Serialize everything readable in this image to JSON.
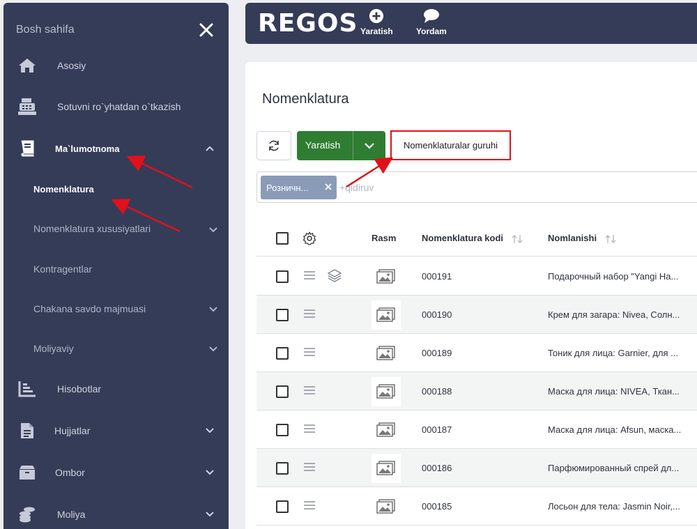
{
  "sidebar": {
    "header": "Bosh sahifa",
    "items": [
      {
        "label": "Asosiy",
        "icon": "home-icon"
      },
      {
        "label": "Sotuvni ro`yhatdan o`tkazish",
        "icon": "cash-register-icon"
      },
      {
        "label": "Ma`lumotnoma",
        "icon": "book-icon"
      },
      {
        "label": "Hisobotlar",
        "icon": "chart-icon"
      },
      {
        "label": "Hujjatlar",
        "icon": "document-icon"
      },
      {
        "label": "Ombor",
        "icon": "box-icon"
      },
      {
        "label": "Moliya",
        "icon": "coins-icon"
      }
    ],
    "subitems": [
      {
        "label": "Nomenklatura"
      },
      {
        "label": "Nomenklatura xususiyatlari"
      },
      {
        "label": "Kontragentlar"
      },
      {
        "label": "Chakana savdo majmuasi"
      },
      {
        "label": "Moliyaviy"
      }
    ]
  },
  "topbar": {
    "logo": "REGOS",
    "create_label": "Yaratish",
    "help_label": "Yordam"
  },
  "main": {
    "title": "Nomenklatura",
    "create_button": "Yaratish",
    "group_button": "Nomenklaturalar guruhi",
    "filter_chip": "Розничн...",
    "search_placeholder": "+qidiruv",
    "columns": {
      "image": "Rasm",
      "code": "Nomenklatura kodi",
      "name": "Nomlanishi"
    },
    "rows": [
      {
        "code": "000191",
        "name": "Подарочный набор \"Yangi На..."
      },
      {
        "code": "000190",
        "name": "Крем для загара: Nivea, Солн..."
      },
      {
        "code": "000189",
        "name": "Тоник для лица: Garnier, для ..."
      },
      {
        "code": "000188",
        "name": "Маска для лица: NIVEA, Ткан..."
      },
      {
        "code": "000187",
        "name": "Маска для лица: Afsun, маска..."
      },
      {
        "code": "000186",
        "name": "Парфюмированный спрей дл..."
      },
      {
        "code": "000185",
        "name": "Лосьон для тела: Jasmin Noir,..."
      }
    ]
  },
  "colors": {
    "sidebar_bg": "#353c58",
    "accent_green": "#2e7d32",
    "annotation_red": "#e0111a",
    "chip_bg": "#8a9bb9"
  }
}
